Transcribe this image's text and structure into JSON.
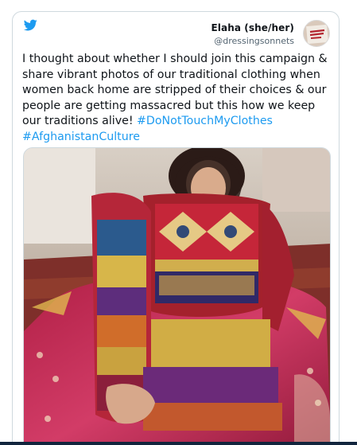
{
  "tweet": {
    "author": {
      "name": "Elaha (she/her)",
      "handle": "@dressingsonnets"
    },
    "avatar_icon": "avatar-sign-icon",
    "brand_icon": "twitter-bird-icon",
    "text_segments": [
      {
        "type": "text",
        "value": "I thought about whether I should join this campaign & share vibrant photos of our traditional clothing when women back home are stripped of their choices & our people are getting massacred but this how we keep our traditions alive! "
      },
      {
        "type": "hashtag",
        "value": "#DoNotTouchMyClothes"
      },
      {
        "type": "text",
        "value": "\n"
      },
      {
        "type": "hashtag",
        "value": "#AfghanistanCulture"
      }
    ],
    "media_description_icon": "photo-icon"
  },
  "colors": {
    "text": "#0f1419",
    "secondary": "#536471",
    "link": "#1d9bf0",
    "border": "#cfd9de",
    "brand": "#1d9bf0"
  }
}
